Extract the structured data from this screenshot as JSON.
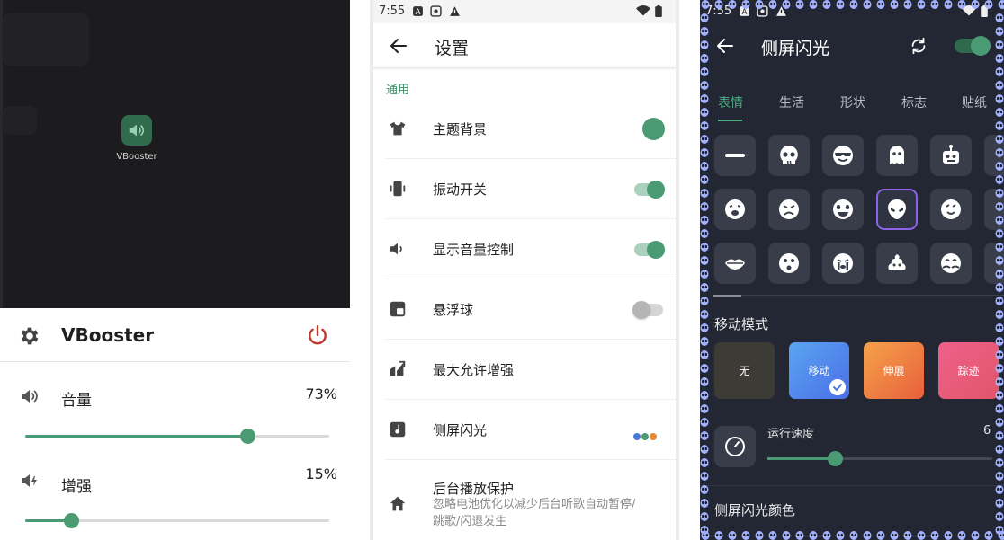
{
  "panel1": {
    "app_icon_label": "VBooster",
    "sheet_title": "VBooster",
    "volume": {
      "label": "音量",
      "percent_text": "73%",
      "value": 0.73
    },
    "boost": {
      "label": "增强",
      "percent_text": "15%",
      "value": 0.15
    },
    "icons": {
      "settings": "gear-icon",
      "power": "power-icon",
      "volume": "speaker-icon",
      "boost": "speaker-boost-icon"
    },
    "colors": {
      "accent": "#4a9a74",
      "power": "#c0392b",
      "launcher_bg": "#1c1c1e"
    }
  },
  "panel2": {
    "status": {
      "time": "7:55"
    },
    "title": "设置",
    "section": "通用",
    "items": [
      {
        "label": "主题背景",
        "control": "color-dot",
        "icon": "shirt-icon"
      },
      {
        "label": "振动开关",
        "control": "toggle-on",
        "icon": "vibrate-icon"
      },
      {
        "label": "显示音量控制",
        "control": "toggle-on",
        "icon": "speaker-icon"
      },
      {
        "label": "悬浮球",
        "control": "toggle-off",
        "icon": "floating-window-icon"
      },
      {
        "label": "最大允许增强",
        "control": "none",
        "icon": "boost-arrow-icon"
      },
      {
        "label": "侧屏闪光",
        "control": "color-dots",
        "icon": "music-note-icon"
      },
      {
        "label": "后台播放保护",
        "sub": "忽略电池优化以减少后台听歌自动暂停/跳歌/闪退发生",
        "control": "none",
        "icon": "home-icon"
      }
    ],
    "colors": {
      "accent": "#4a9a74",
      "dots": [
        "#4a7ad6",
        "#4a9a74",
        "#e08a3a"
      ]
    }
  },
  "panel3": {
    "status": {
      "time": "7:55"
    },
    "title": "侧屏闪光",
    "tabs": [
      "表情",
      "生活",
      "形状",
      "标志",
      "贴纸"
    ],
    "active_tab": "表情",
    "emoji_icons": [
      "dash-icon",
      "skull-icon",
      "sunglasses-face-icon",
      "ghost-icon",
      "robot-icon",
      "drool-face-icon",
      "frown-face-icon",
      "heart-eyes-face-icon",
      "alien-icon",
      "tongue-face-icon",
      "lips-icon",
      "surprised-face-icon",
      "crying-face-icon",
      "poop-icon",
      "hug-face-icon"
    ],
    "selected_emoji": "alien-icon",
    "move_mode": {
      "heading": "移动模式",
      "options": [
        {
          "label": "无",
          "selected": false
        },
        {
          "label": "移动",
          "selected": true
        },
        {
          "label": "伸展",
          "selected": false
        },
        {
          "label": "踪迹",
          "selected": false
        }
      ]
    },
    "speed": {
      "label": "运行速度",
      "value_text": "6",
      "value": 6,
      "max": 20
    },
    "color_heading": "侧屏闪光颜色",
    "colors": {
      "accent": "#4fae85",
      "selection": "#8c63e6",
      "edge_emoji": "#a3b2ff"
    }
  }
}
